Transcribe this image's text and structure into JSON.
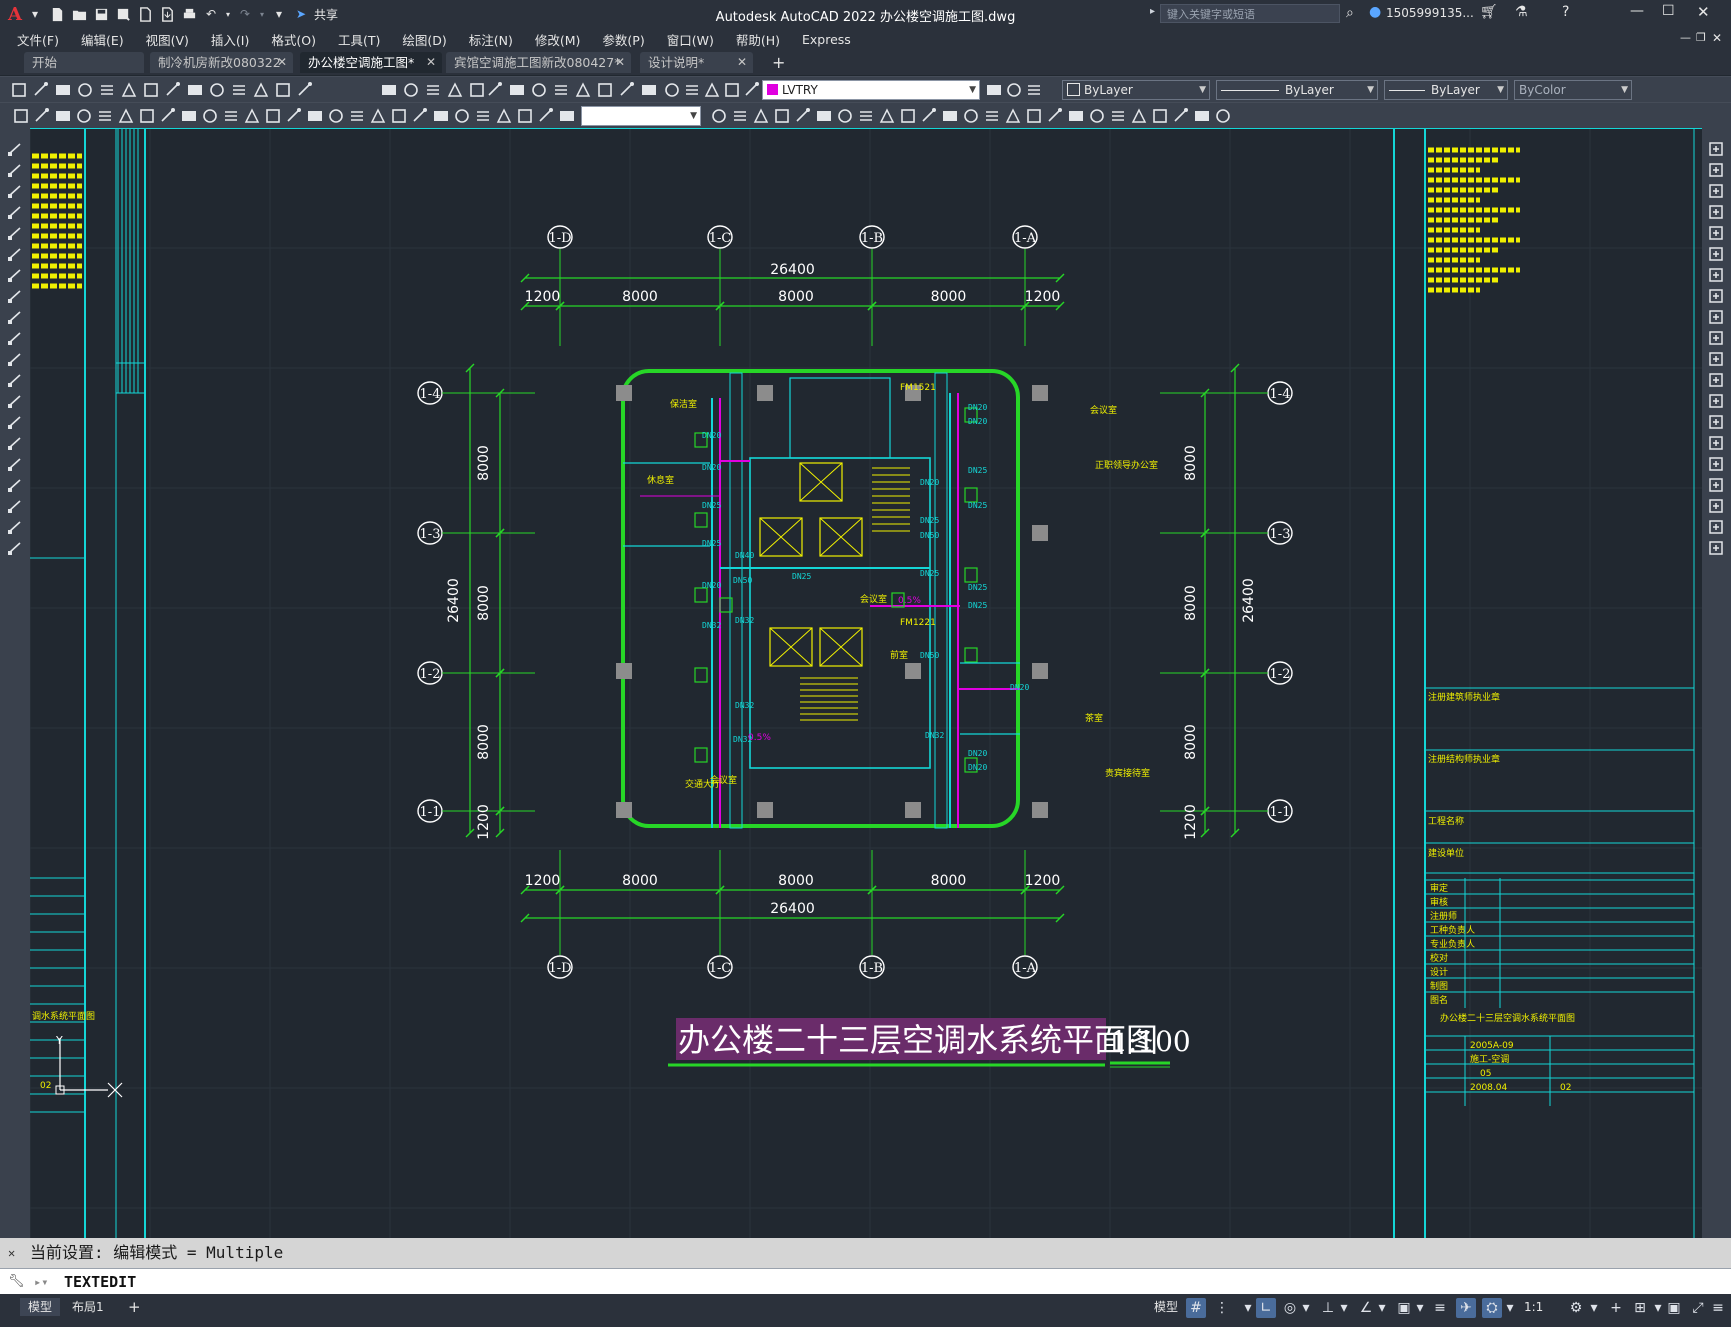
{
  "app": {
    "title": "Autodesk AutoCAD 2022    办公楼空调施工图.dwg",
    "logo": "A",
    "share_label": "共享",
    "search_placeholder": "键入关键字或短语",
    "user": "1505999135...",
    "window_controls": [
      "minimize-icon",
      "maximize-icon",
      "close-icon"
    ]
  },
  "menubar": [
    "文件(F)",
    "编辑(E)",
    "视图(V)",
    "插入(I)",
    "格式(O)",
    "工具(T)",
    "绘图(D)",
    "标注(N)",
    "修改(M)",
    "参数(P)",
    "窗口(W)",
    "帮助(H)",
    "Express"
  ],
  "tabs": [
    {
      "label": "开始",
      "active": false
    },
    {
      "label": "制冷机房新改080322",
      "active": false
    },
    {
      "label": "办公楼空调施工图*",
      "active": true
    },
    {
      "label": "宾馆空调施工图新改080427*",
      "active": false
    },
    {
      "label": "设计说明*",
      "active": false
    }
  ],
  "toolbar": {
    "layer": "LVTRY",
    "color": "ByLayer",
    "linetype": "ByLayer",
    "lineweight": "ByLayer",
    "plotstyle": "ByColor",
    "layer_color": "#e000e0"
  },
  "drawing": {
    "title": "办公楼二十三层空调水系统平面图",
    "scale": "1:100",
    "axes_top": [
      "1-D",
      "1-C",
      "1-B",
      "1-A"
    ],
    "axes_side": [
      "1-4",
      "1-3",
      "1-2",
      "1-1"
    ],
    "dim_total": "26400",
    "dim_spans_h": [
      "1200",
      "8000",
      "8000",
      "8000",
      "1200"
    ],
    "dim_spans_v": [
      "8000",
      "8000",
      "8000",
      "1200"
    ],
    "rooms": [
      "保洁室",
      "休息室",
      "会议室",
      "正职领导办公室",
      "交通大厅",
      "会议室",
      "贵宾接待室",
      "茶室",
      "备用室",
      "前室",
      "FM1521",
      "FM1221"
    ],
    "pipe_labels": [
      "DN20",
      "DN25",
      "DN32",
      "DN40",
      "DN50"
    ],
    "slope_label": "0.5%",
    "view_cube_label": "Y",
    "title_block": {
      "fields": [
        "注册建筑师执业章",
        "注册结构师执业章",
        "工程名称",
        "建设单位",
        "审定",
        "审核",
        "注册师",
        "工种负责人",
        "专业负责人",
        "校对",
        "设计",
        "制图",
        "图名"
      ],
      "sheet_name": "办公楼二十三层空调水系统平面图",
      "project_no": "2005A-09",
      "phase": "施工-空调",
      "sheet_no": "05",
      "date": "2008.04",
      "rev": "02"
    },
    "left_strip_caption": "调水系统平面图",
    "left_strip_no": "02"
  },
  "command": {
    "history": "当前设置: 编辑模式 = Multiple",
    "current": "TEXTEDIT"
  },
  "status": {
    "layout_tabs": [
      "模型",
      "布局1"
    ],
    "model_label": "模型",
    "scale": "1:1"
  }
}
